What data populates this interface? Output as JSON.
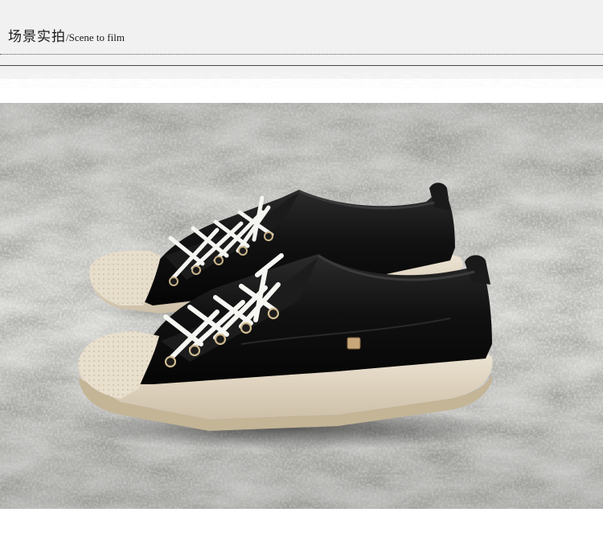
{
  "header": {
    "title_cn": "场景实拍",
    "title_separator": "/",
    "title_en": "Scene to film"
  },
  "photo": {
    "subject": "product-photo"
  },
  "colors": {
    "header_bg": "#f1f1f1",
    "title_text": "#1a1a1a",
    "floor": "#8f8f8a",
    "shoe_leather": "#141414",
    "sole": "#e6dccb",
    "laces": "#f5f5f2"
  }
}
